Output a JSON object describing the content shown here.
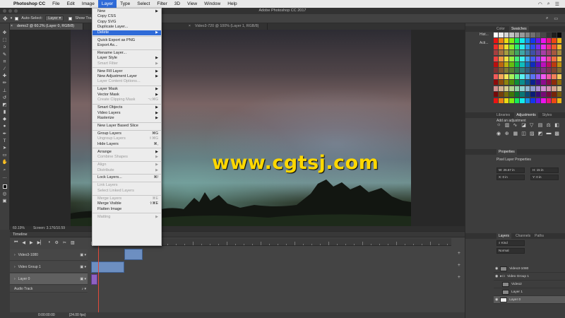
{
  "menubar": {
    "app_name": "Photoshop CC",
    "items": [
      "File",
      "Edit",
      "Image",
      "Layer",
      "Type",
      "Select",
      "Filter",
      "3D",
      "View",
      "Window",
      "Help"
    ],
    "active_index": 3
  },
  "window": {
    "title": "Adobe Photoshop CC 2017"
  },
  "options": {
    "auto_select_label": "Auto-Select:",
    "auto_select_value": "Layer",
    "show_transform_label": "Show Transfor"
  },
  "tabs": [
    {
      "label": "demo2 @ 60.2% (Layer 0, RGB/8)",
      "active": true
    },
    {
      "label": "Video3-720 @ 100% (Layer 1, RGB/8)",
      "active": false
    }
  ],
  "canvas": {
    "watermark": "www.cgtsj.com"
  },
  "status": {
    "zoom": "60.19%",
    "info": "Screen: 3.176/10.59"
  },
  "timeline": {
    "title": "Timeline",
    "tracks": [
      "Video3-1080",
      "Video Group 1",
      "Layer 0",
      "Audio Track"
    ],
    "timecode": "0:00:00:00",
    "fps": "(24.00 fps)"
  },
  "panels": {
    "color_tabs": [
      "Color",
      "Swatches"
    ],
    "side_labels": [
      "Hist...",
      "Acti..."
    ],
    "adjust_tabs": [
      "Libraries",
      "Adjustments",
      "Styles"
    ],
    "adjust_hint": "Add an adjustment",
    "properties_title": "Properties",
    "properties_sub": "Pixel Layer Properties",
    "props": {
      "w": "W: 26.67 in",
      "h": "H: 15 in",
      "x": "X: 0 in",
      "y": "Y: 0 in"
    },
    "layers_tabs": [
      "Layers",
      "Channels",
      "Paths"
    ],
    "kind_label": "Kind",
    "blend": "Normal",
    "layers": [
      "Video3-1080",
      "Video Group 1",
      "Video2",
      "Layer 1",
      "Layer 0"
    ]
  },
  "layer_menu": {
    "items": [
      {
        "label": "New",
        "shortcut": "▶"
      },
      {
        "label": "Copy CSS",
        "shortcut": ""
      },
      {
        "label": "Copy SVG",
        "shortcut": ""
      },
      {
        "label": "Duplicate Layer...",
        "shortcut": ""
      },
      {
        "label": "Delete",
        "shortcut": "▶",
        "highlight": true
      },
      {
        "sep": true
      },
      {
        "label": "Quick Export as PNG",
        "shortcut": ""
      },
      {
        "label": "Export As...",
        "shortcut": ""
      },
      {
        "sep": true
      },
      {
        "label": "Rename Layer...",
        "shortcut": ""
      },
      {
        "label": "Layer Style",
        "shortcut": "▶"
      },
      {
        "label": "Smart Filter",
        "shortcut": "▶",
        "disabled": true
      },
      {
        "sep": true
      },
      {
        "label": "New Fill Layer",
        "shortcut": "▶"
      },
      {
        "label": "New Adjustment Layer",
        "shortcut": "▶"
      },
      {
        "label": "Layer Content Options...",
        "shortcut": "",
        "disabled": true
      },
      {
        "sep": true
      },
      {
        "label": "Layer Mask",
        "shortcut": "▶"
      },
      {
        "label": "Vector Mask",
        "shortcut": "▶"
      },
      {
        "label": "Create Clipping Mask",
        "shortcut": "⌥⌘G",
        "disabled": true
      },
      {
        "sep": true
      },
      {
        "label": "Smart Objects",
        "shortcut": "▶"
      },
      {
        "label": "Video Layers",
        "shortcut": "▶"
      },
      {
        "label": "Rasterize",
        "shortcut": "▶"
      },
      {
        "sep": true
      },
      {
        "label": "New Layer Based Slice",
        "shortcut": ""
      },
      {
        "sep": true
      },
      {
        "label": "Group Layers",
        "shortcut": "⌘G"
      },
      {
        "label": "Ungroup Layers",
        "shortcut": "⇧⌘G",
        "disabled": true
      },
      {
        "label": "Hide Layers",
        "shortcut": "⌘,"
      },
      {
        "sep": true
      },
      {
        "label": "Arrange",
        "shortcut": "▶"
      },
      {
        "label": "Combine Shapes",
        "shortcut": "▶",
        "disabled": true
      },
      {
        "sep": true
      },
      {
        "label": "Align",
        "shortcut": "▶",
        "disabled": true
      },
      {
        "label": "Distribute",
        "shortcut": "▶",
        "disabled": true
      },
      {
        "sep": true
      },
      {
        "label": "Lock Layers...",
        "shortcut": "⌘/"
      },
      {
        "sep": true
      },
      {
        "label": "Link Layers",
        "shortcut": "",
        "disabled": true
      },
      {
        "label": "Select Linked Layers",
        "shortcut": "",
        "disabled": true
      },
      {
        "sep": true
      },
      {
        "label": "Merge Layers",
        "shortcut": "⌘E",
        "disabled": true
      },
      {
        "label": "Merge Visible",
        "shortcut": "⇧⌘E"
      },
      {
        "label": "Flatten Image",
        "shortcut": ""
      },
      {
        "sep": true
      },
      {
        "label": "Matting",
        "shortcut": "▶",
        "disabled": true
      }
    ]
  },
  "colors": {
    "menu_highlight": "#2f6bd8",
    "watermark": "#ffd800",
    "clip_blue": "#6d8fc1",
    "clip_purple": "#8e62c2",
    "playhead": "#e2493a"
  }
}
